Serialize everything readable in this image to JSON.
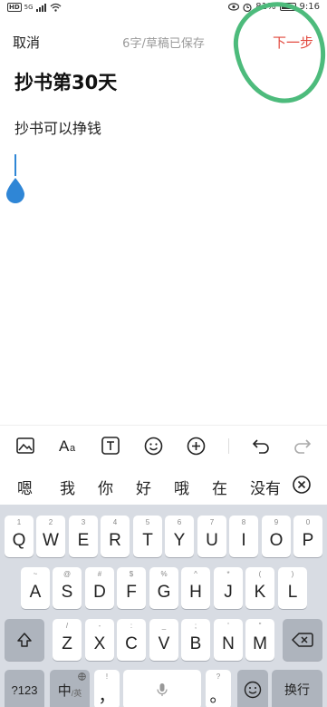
{
  "status": {
    "hd": "HD",
    "signal": "5G",
    "battery": "81%",
    "time": "9:16"
  },
  "header": {
    "cancel": "取消",
    "draft_status": "6字/草稿已保存",
    "next": "下一步"
  },
  "editor": {
    "title": "抄书第30天",
    "body": "抄书可以挣钱"
  },
  "toolbar": {
    "icons": [
      "image-icon",
      "text-format-icon",
      "text-box-icon",
      "emoji-icon",
      "add-icon",
      "undo-icon",
      "redo-icon"
    ]
  },
  "candidates": [
    "嗯",
    "我",
    "你",
    "好",
    "哦",
    "在",
    "没有"
  ],
  "keyboard": {
    "row1": [
      {
        "hint": "1",
        "key": "Q"
      },
      {
        "hint": "2",
        "key": "W"
      },
      {
        "hint": "3",
        "key": "E"
      },
      {
        "hint": "4",
        "key": "R"
      },
      {
        "hint": "5",
        "key": "T"
      },
      {
        "hint": "6",
        "key": "Y"
      },
      {
        "hint": "7",
        "key": "U"
      },
      {
        "hint": "8",
        "key": "I"
      },
      {
        "hint": "9",
        "key": "O"
      },
      {
        "hint": "0",
        "key": "P"
      }
    ],
    "row2": [
      {
        "hint": "~",
        "key": "A"
      },
      {
        "hint": "@",
        "key": "S"
      },
      {
        "hint": "#",
        "key": "D"
      },
      {
        "hint": "$",
        "key": "F"
      },
      {
        "hint": "%",
        "key": "G"
      },
      {
        "hint": "^",
        "key": "H"
      },
      {
        "hint": "*",
        "key": "J"
      },
      {
        "hint": "(",
        "key": "K"
      },
      {
        "hint": ")",
        "key": "L"
      }
    ],
    "row3": [
      {
        "hint": "/",
        "key": "Z"
      },
      {
        "hint": "-",
        "key": "X"
      },
      {
        "hint": ":",
        "key": "C"
      },
      {
        "hint": "_",
        "key": "V"
      },
      {
        "hint": ";",
        "key": "B"
      },
      {
        "hint": "'",
        "key": "N"
      },
      {
        "hint": "\"",
        "key": "M"
      }
    ],
    "num_key": "?123",
    "lang_key": "中",
    "lang_sub": "/英",
    "comma_key": "，",
    "comma_hint": "!",
    "period_key": "。",
    "period_hint": "?",
    "enter_key": "换行"
  }
}
